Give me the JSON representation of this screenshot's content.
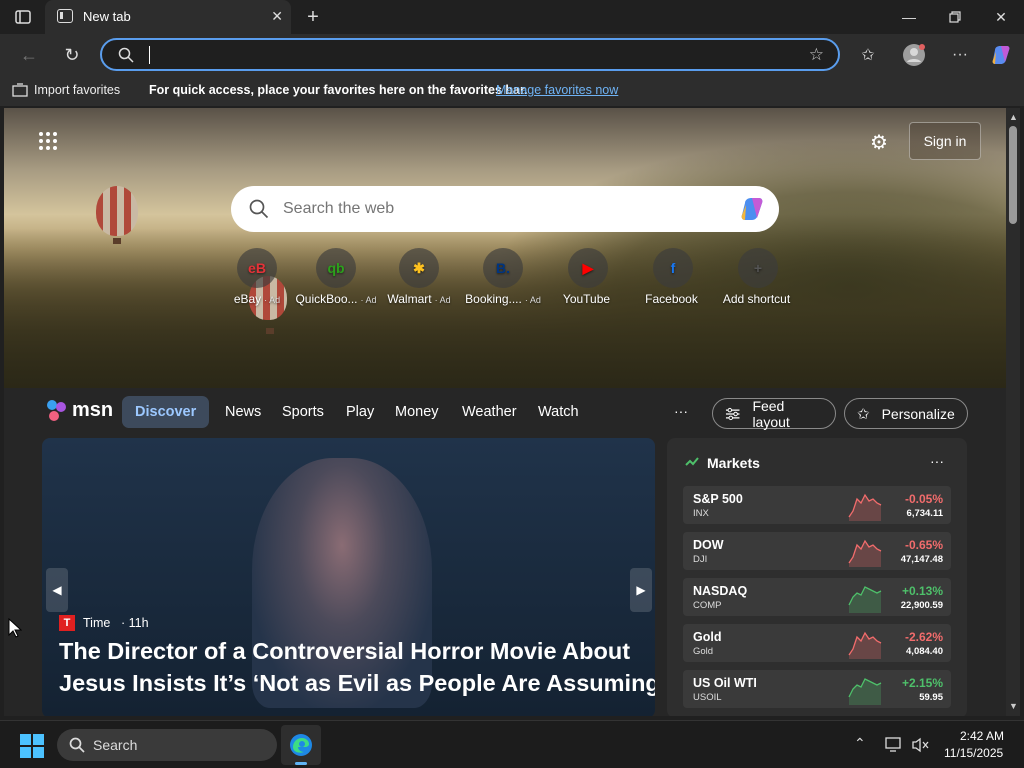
{
  "browser": {
    "tab_title": "New tab",
    "address_value": "",
    "favbar_import": "Import favorites",
    "favbar_message": "For quick access, place your favorites here on the favorites bar.",
    "favbar_link": "Manage favorites now"
  },
  "newtab": {
    "sign_in": "Sign in",
    "search_placeholder": "Search the web",
    "shortcuts": [
      {
        "label": "eBay",
        "ad": "· Ad",
        "glyph": "eB",
        "color": "#e53238"
      },
      {
        "label": "QuickBoo...",
        "ad": "· Ad",
        "glyph": "qb",
        "color": "#2ca01c"
      },
      {
        "label": "Walmart",
        "ad": "· Ad",
        "glyph": "✱",
        "color": "#ffc220"
      },
      {
        "label": "Booking....",
        "ad": "· Ad",
        "glyph": "B.",
        "color": "#003580"
      },
      {
        "label": "YouTube",
        "ad": "",
        "glyph": "▶",
        "color": "#ff0000"
      },
      {
        "label": "Facebook",
        "ad": "",
        "glyph": "f",
        "color": "#1877f2"
      },
      {
        "label": "Add shortcut",
        "ad": "",
        "glyph": "+",
        "color": "#555555"
      }
    ]
  },
  "msn": {
    "logo": "msn",
    "nav": [
      "Discover",
      "News",
      "Sports",
      "Play",
      "Money",
      "Weather",
      "Watch"
    ],
    "more": "···",
    "feed_layout": "Feed layout",
    "personalize": "Personalize",
    "headline": {
      "source": "Time",
      "age": "· 11h",
      "title_line1": "The Director of a Controversial Horror Movie About",
      "title_line2": "Jesus Insists It’s ‘Not as Evil as People Are Assuming’"
    },
    "markets": {
      "title": "Markets",
      "items": [
        {
          "name": "S&P 500",
          "symbol": "INX",
          "change": "-0.05%",
          "value": "6,734.11",
          "trend": "down"
        },
        {
          "name": "DOW",
          "symbol": "DJI",
          "change": "-0.65%",
          "value": "47,147.48",
          "trend": "down"
        },
        {
          "name": "NASDAQ",
          "symbol": "COMP",
          "change": "+0.13%",
          "value": "22,900.59",
          "trend": "up"
        },
        {
          "name": "Gold",
          "symbol": "Gold",
          "change": "-2.62%",
          "value": "4,084.40",
          "trend": "down"
        },
        {
          "name": "US Oil WTI",
          "symbol": "USOIL",
          "change": "+2.15%",
          "value": "59.95",
          "trend": "up"
        }
      ]
    }
  },
  "taskbar": {
    "search": "Search",
    "time": "2:42 AM",
    "date": "11/15/2025"
  },
  "colors": {
    "accent": "#5a9ded",
    "up": "#4ec06a",
    "down": "#f26c6c"
  }
}
